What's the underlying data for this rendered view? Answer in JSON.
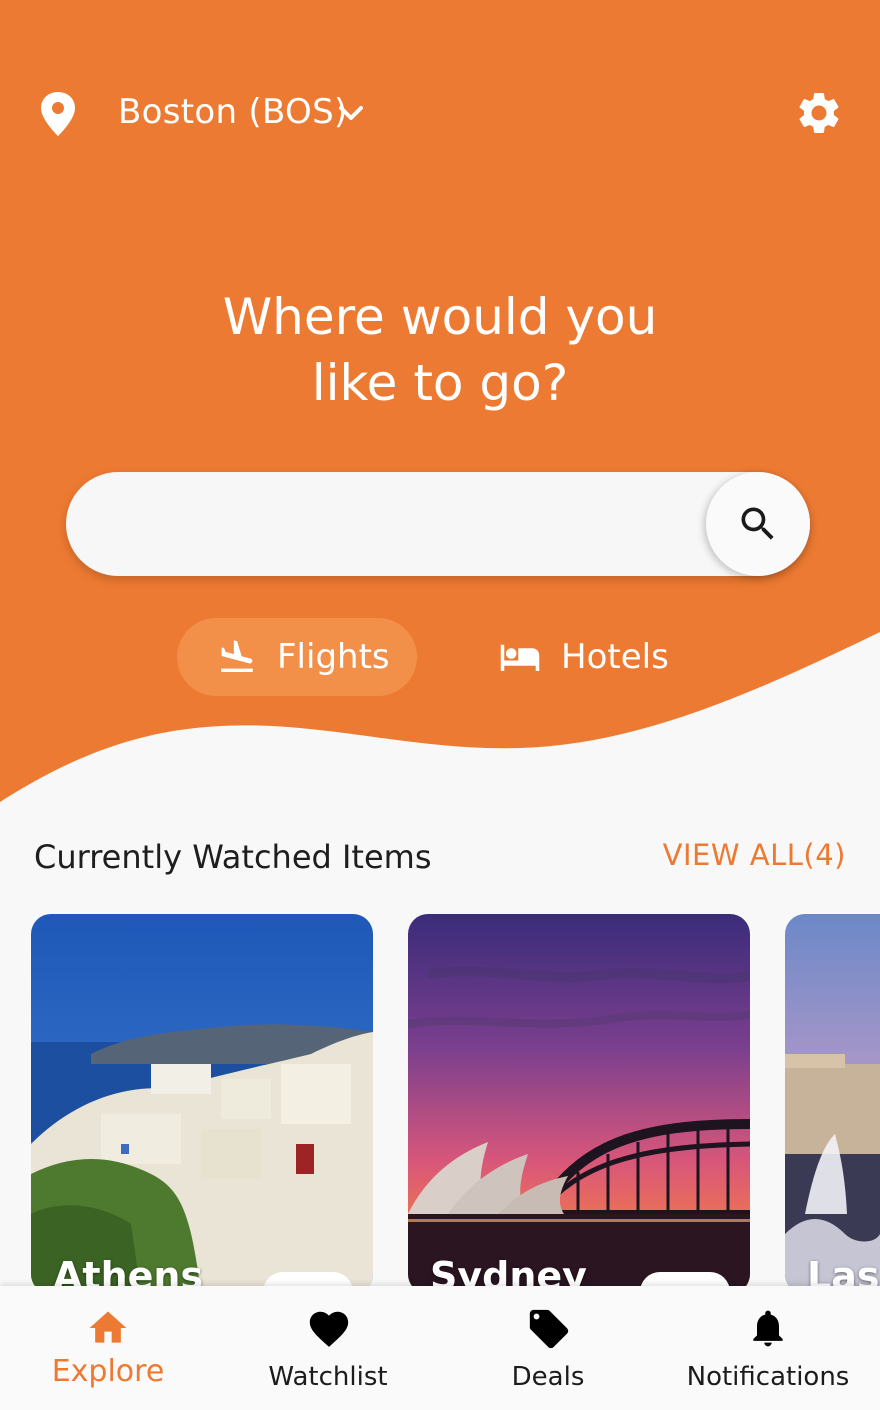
{
  "colors": {
    "accent": "#ed7a32",
    "pill": "#f2904a",
    "background": "#f8f8f8"
  },
  "header": {
    "location_label": "Boston (BOS)",
    "location_icon": "map-pin-icon",
    "dropdown_icon": "chevron-down-icon",
    "settings_icon": "gear-icon"
  },
  "hero": {
    "headline_line1": "Where would you",
    "headline_line2": "like to go?"
  },
  "search": {
    "placeholder": "",
    "value": "",
    "icon": "search-icon"
  },
  "modes": [
    {
      "label": "Flights",
      "icon": "plane-landing-icon",
      "active": true
    },
    {
      "label": "Hotels",
      "icon": "bed-icon",
      "active": false
    }
  ],
  "watched": {
    "title": "Currently Watched Items",
    "view_all": "VIEW ALL(4)",
    "cards": [
      {
        "name": "Athens"
      },
      {
        "name": "Sydney"
      },
      {
        "name": "Las V"
      }
    ]
  },
  "nav": [
    {
      "label": "Explore",
      "icon": "home-icon",
      "active": true
    },
    {
      "label": "Watchlist",
      "icon": "heart-icon",
      "active": false
    },
    {
      "label": "Deals",
      "icon": "tag-icon",
      "active": false
    },
    {
      "label": "Notifications",
      "icon": "bell-icon",
      "active": false
    }
  ]
}
